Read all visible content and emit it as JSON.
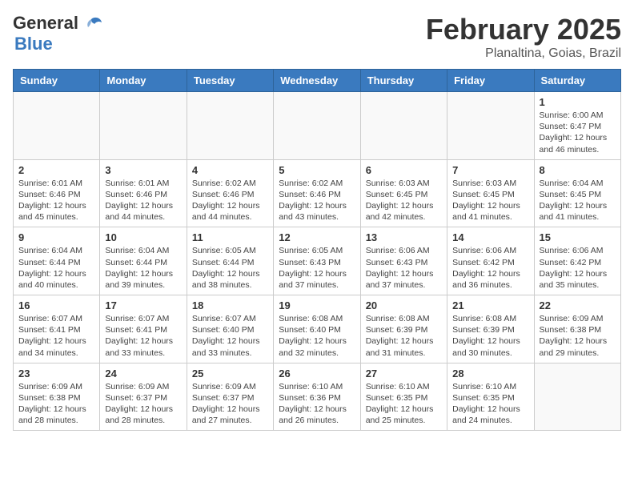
{
  "header": {
    "logo_general": "General",
    "logo_blue": "Blue",
    "month": "February 2025",
    "location": "Planaltina, Goias, Brazil"
  },
  "weekdays": [
    "Sunday",
    "Monday",
    "Tuesday",
    "Wednesday",
    "Thursday",
    "Friday",
    "Saturday"
  ],
  "weeks": [
    [
      {
        "day": "",
        "info": ""
      },
      {
        "day": "",
        "info": ""
      },
      {
        "day": "",
        "info": ""
      },
      {
        "day": "",
        "info": ""
      },
      {
        "day": "",
        "info": ""
      },
      {
        "day": "",
        "info": ""
      },
      {
        "day": "1",
        "info": "Sunrise: 6:00 AM\nSunset: 6:47 PM\nDaylight: 12 hours and 46 minutes."
      }
    ],
    [
      {
        "day": "2",
        "info": "Sunrise: 6:01 AM\nSunset: 6:46 PM\nDaylight: 12 hours and 45 minutes."
      },
      {
        "day": "3",
        "info": "Sunrise: 6:01 AM\nSunset: 6:46 PM\nDaylight: 12 hours and 44 minutes."
      },
      {
        "day": "4",
        "info": "Sunrise: 6:02 AM\nSunset: 6:46 PM\nDaylight: 12 hours and 44 minutes."
      },
      {
        "day": "5",
        "info": "Sunrise: 6:02 AM\nSunset: 6:46 PM\nDaylight: 12 hours and 43 minutes."
      },
      {
        "day": "6",
        "info": "Sunrise: 6:03 AM\nSunset: 6:45 PM\nDaylight: 12 hours and 42 minutes."
      },
      {
        "day": "7",
        "info": "Sunrise: 6:03 AM\nSunset: 6:45 PM\nDaylight: 12 hours and 41 minutes."
      },
      {
        "day": "8",
        "info": "Sunrise: 6:04 AM\nSunset: 6:45 PM\nDaylight: 12 hours and 41 minutes."
      }
    ],
    [
      {
        "day": "9",
        "info": "Sunrise: 6:04 AM\nSunset: 6:44 PM\nDaylight: 12 hours and 40 minutes."
      },
      {
        "day": "10",
        "info": "Sunrise: 6:04 AM\nSunset: 6:44 PM\nDaylight: 12 hours and 39 minutes."
      },
      {
        "day": "11",
        "info": "Sunrise: 6:05 AM\nSunset: 6:44 PM\nDaylight: 12 hours and 38 minutes."
      },
      {
        "day": "12",
        "info": "Sunrise: 6:05 AM\nSunset: 6:43 PM\nDaylight: 12 hours and 37 minutes."
      },
      {
        "day": "13",
        "info": "Sunrise: 6:06 AM\nSunset: 6:43 PM\nDaylight: 12 hours and 37 minutes."
      },
      {
        "day": "14",
        "info": "Sunrise: 6:06 AM\nSunset: 6:42 PM\nDaylight: 12 hours and 36 minutes."
      },
      {
        "day": "15",
        "info": "Sunrise: 6:06 AM\nSunset: 6:42 PM\nDaylight: 12 hours and 35 minutes."
      }
    ],
    [
      {
        "day": "16",
        "info": "Sunrise: 6:07 AM\nSunset: 6:41 PM\nDaylight: 12 hours and 34 minutes."
      },
      {
        "day": "17",
        "info": "Sunrise: 6:07 AM\nSunset: 6:41 PM\nDaylight: 12 hours and 33 minutes."
      },
      {
        "day": "18",
        "info": "Sunrise: 6:07 AM\nSunset: 6:40 PM\nDaylight: 12 hours and 33 minutes."
      },
      {
        "day": "19",
        "info": "Sunrise: 6:08 AM\nSunset: 6:40 PM\nDaylight: 12 hours and 32 minutes."
      },
      {
        "day": "20",
        "info": "Sunrise: 6:08 AM\nSunset: 6:39 PM\nDaylight: 12 hours and 31 minutes."
      },
      {
        "day": "21",
        "info": "Sunrise: 6:08 AM\nSunset: 6:39 PM\nDaylight: 12 hours and 30 minutes."
      },
      {
        "day": "22",
        "info": "Sunrise: 6:09 AM\nSunset: 6:38 PM\nDaylight: 12 hours and 29 minutes."
      }
    ],
    [
      {
        "day": "23",
        "info": "Sunrise: 6:09 AM\nSunset: 6:38 PM\nDaylight: 12 hours and 28 minutes."
      },
      {
        "day": "24",
        "info": "Sunrise: 6:09 AM\nSunset: 6:37 PM\nDaylight: 12 hours and 28 minutes."
      },
      {
        "day": "25",
        "info": "Sunrise: 6:09 AM\nSunset: 6:37 PM\nDaylight: 12 hours and 27 minutes."
      },
      {
        "day": "26",
        "info": "Sunrise: 6:10 AM\nSunset: 6:36 PM\nDaylight: 12 hours and 26 minutes."
      },
      {
        "day": "27",
        "info": "Sunrise: 6:10 AM\nSunset: 6:35 PM\nDaylight: 12 hours and 25 minutes."
      },
      {
        "day": "28",
        "info": "Sunrise: 6:10 AM\nSunset: 6:35 PM\nDaylight: 12 hours and 24 minutes."
      },
      {
        "day": "",
        "info": ""
      }
    ]
  ]
}
